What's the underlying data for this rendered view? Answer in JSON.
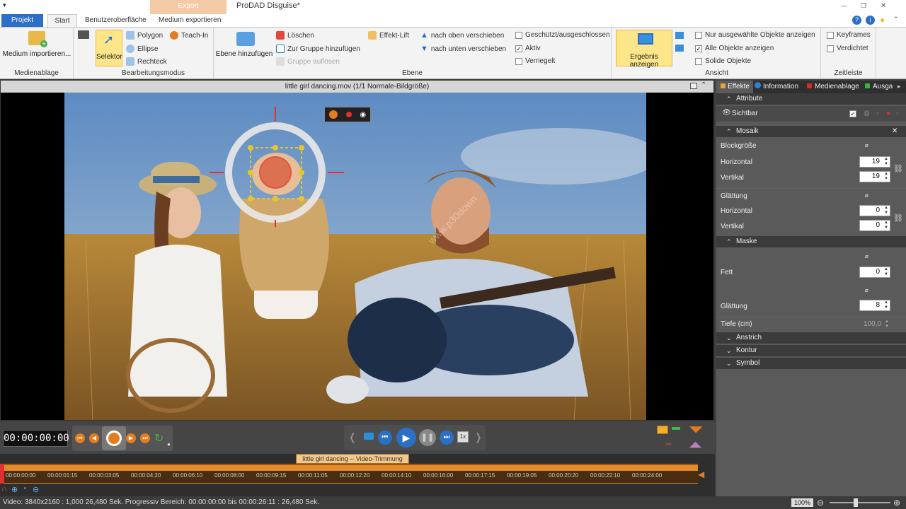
{
  "window": {
    "title": "ProDAD Disguise*",
    "menu_arrow": "▾",
    "export_tab": "Export",
    "controls": [
      "—",
      "❐",
      "✕"
    ]
  },
  "tabs": {
    "projekt": "Projekt",
    "start": "Start",
    "benutzer": "Benutzeroberfläche",
    "medium_exportieren": "Medium exportieren"
  },
  "ribbon": {
    "medienablage": {
      "label": "Medienablage",
      "import": "Medium importieren..."
    },
    "bearbeitungsmodus": {
      "label": "Bearbeitungsmodus",
      "selektor": "Selektor",
      "polygon": "Polygon",
      "ellipse": "Ellipse",
      "rechteck": "Rechteck",
      "teachin": "Teach-In"
    },
    "ebene": {
      "label": "Ebene",
      "hinzufuegen": "Ebene hinzufügen",
      "loeschen": "Löschen",
      "zur_gruppe": "Zur Gruppe hinzufügen",
      "gruppe_aufloesen": "Gruppe auflösen",
      "effekt_lift": "Effekt-Lift",
      "nach_oben": "nach oben verschieben",
      "nach_unten": "nach unten verschieben",
      "geschuetzt": "Geschützt/ausgeschlossen",
      "aktiv": "Aktiv",
      "verriegelt": "Verriegelt"
    },
    "ansicht": {
      "label": "Ansicht",
      "ergebnis": "Ergebnis anzeigen",
      "nur_ausgewaehlte": "Nur ausgewählte Objekte anzeigen",
      "alle_objekte": "Alle Objekte anzeigen",
      "solide": "Solide Objekte"
    },
    "zeitleiste": {
      "label": "Zeitleiste",
      "keyframes": "Keyframes",
      "verdichtet": "Verdichtet"
    }
  },
  "video": {
    "header": "little girl dancing.mov   (1/1  Normale-Bildgröße)",
    "watermark": "www.p30down"
  },
  "transport": {
    "timecode": "00:00:00:00",
    "speed": "1x"
  },
  "timeline": {
    "clip_label": "little girl dancing -- Video-Trimmung",
    "ticks": [
      "00:00:00:00",
      "00:00:01:15",
      "00:00:03:05",
      "00:00:04:20",
      "00:00:06:10",
      "00:00:08:00",
      "00:00:09:15",
      "00:00:11:05",
      "00:00:12:20",
      "00:00:14:10",
      "00:00:16:00",
      "00:00:17:15",
      "00:00:19:05",
      "00:00:20:20",
      "00:00:22:10",
      "00:00:24:00"
    ]
  },
  "panel": {
    "tabs": [
      "Effekte",
      "Information",
      "Medienablage",
      "Ausga"
    ],
    "tab_colors": [
      "#e8a33a",
      "#2f7fd6",
      "#d62a2a",
      "#3cb043"
    ],
    "attribute": {
      "title": "Attribute",
      "sichtbar": "Sichtbar"
    },
    "mosaik": {
      "title": "Mosaik",
      "blockgroesse": "Blockgröße",
      "horizontal": "Horizontal",
      "vertikal": "Vertikal",
      "h_val": "19",
      "v_val": "19",
      "glaettung": "Glättung",
      "gh_val": "0",
      "gv_val": "0"
    },
    "maske": {
      "title": "Maske",
      "fett": "Fett",
      "fett_val": "0",
      "glaettung": "Glättung",
      "glaettung_val": "8",
      "tiefe": "Tiefe (cm)",
      "tiefe_val": "100,0"
    },
    "collapsed": [
      "Anstrich",
      "Kontur",
      "Symbol"
    ]
  },
  "status": {
    "text": "Video: 3840x2160 : 1,000  26,480 Sek.  Progressiv  Bereich: 00:00:00:00 bis 00:00:26:11 : 26,480 Sek.",
    "zoom": "100%"
  }
}
